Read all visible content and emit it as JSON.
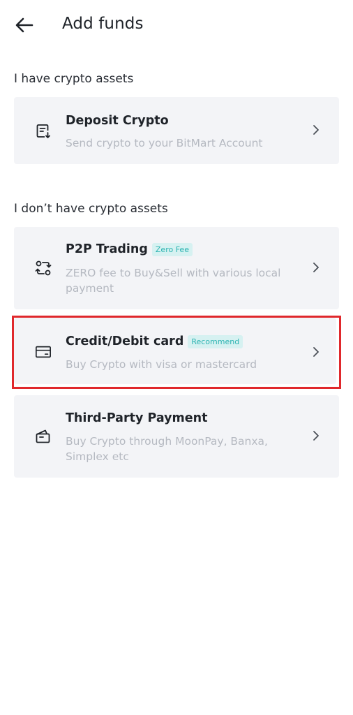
{
  "header": {
    "title": "Add funds",
    "back_icon": "arrow-left-icon"
  },
  "sections": [
    {
      "label": "I have crypto assets",
      "items": [
        {
          "title": "Deposit Crypto",
          "description": "Send crypto to your BitMart Account",
          "icon": "deposit-list-icon"
        }
      ]
    },
    {
      "label": "I don’t have crypto assets",
      "items": [
        {
          "title": "P2P Trading",
          "badge": "Zero Fee",
          "description": "ZERO fee to Buy&Sell with various local payment",
          "icon": "p2p-exchange-icon"
        },
        {
          "title": "Credit/Debit card",
          "badge": "Recommend",
          "description": "Buy Crypto with visa or mastercard",
          "icon": "credit-card-icon"
        },
        {
          "title": "Third-Party Payment",
          "description": "Buy Crypto through MoonPay, Banxa, Simplex etc",
          "icon": "wallet-icon"
        }
      ]
    }
  ],
  "colors": {
    "card_bg": "#f3f4f7",
    "badge_text": "#2ab3b1",
    "badge_bg": "#d6f1f1",
    "highlight": "#e0282c"
  }
}
